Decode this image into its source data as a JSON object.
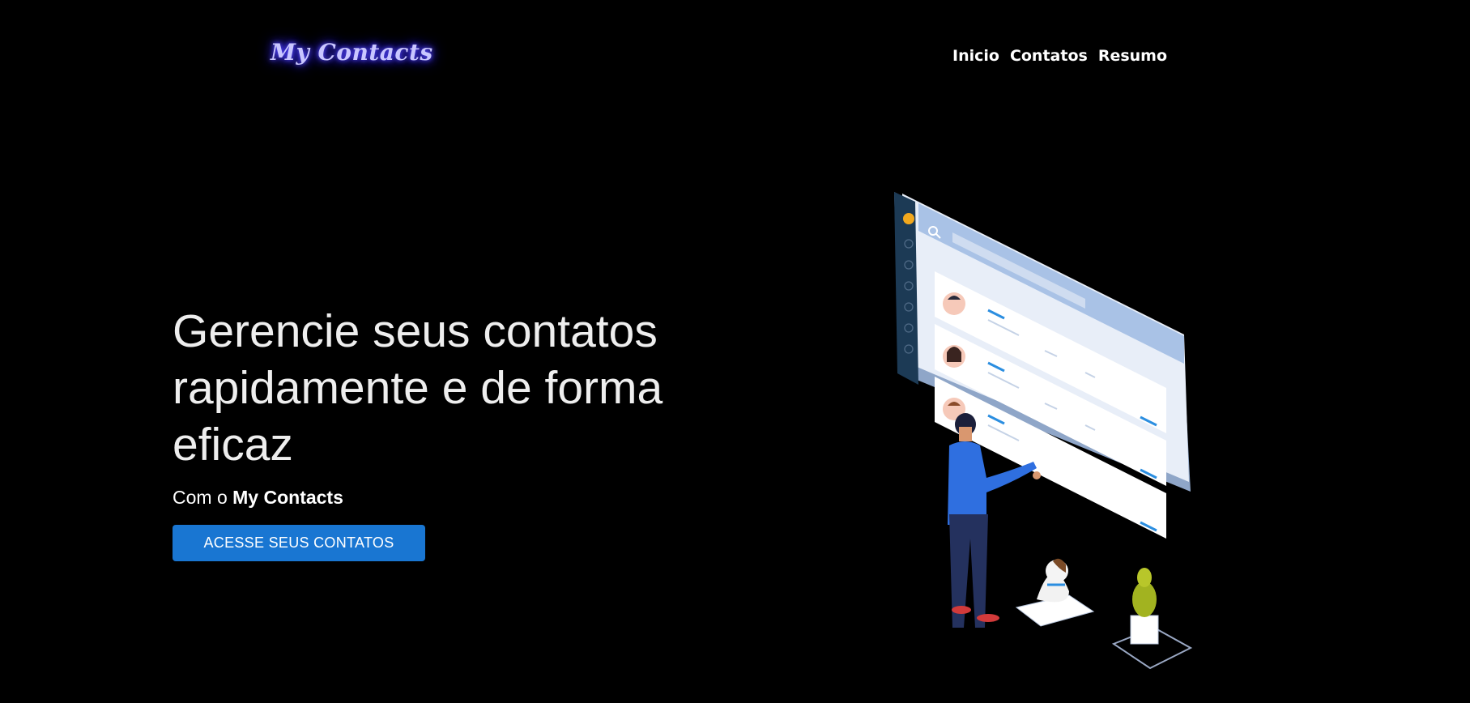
{
  "header": {
    "logo_text": "My Contacts",
    "nav": [
      {
        "label": "Inicio"
      },
      {
        "label": "Contatos"
      },
      {
        "label": "Resumo"
      }
    ]
  },
  "hero": {
    "title": "Gerencie seus contatos rapidamente e de forma eficaz",
    "subtitle_prefix": "Com o ",
    "subtitle_brand": "My Contacts",
    "cta_label": "ACESSE SEUS CONTATOS"
  },
  "colors": {
    "background": "#000000",
    "accent": "#1976d2",
    "logo_glow": "#4a3cff"
  }
}
